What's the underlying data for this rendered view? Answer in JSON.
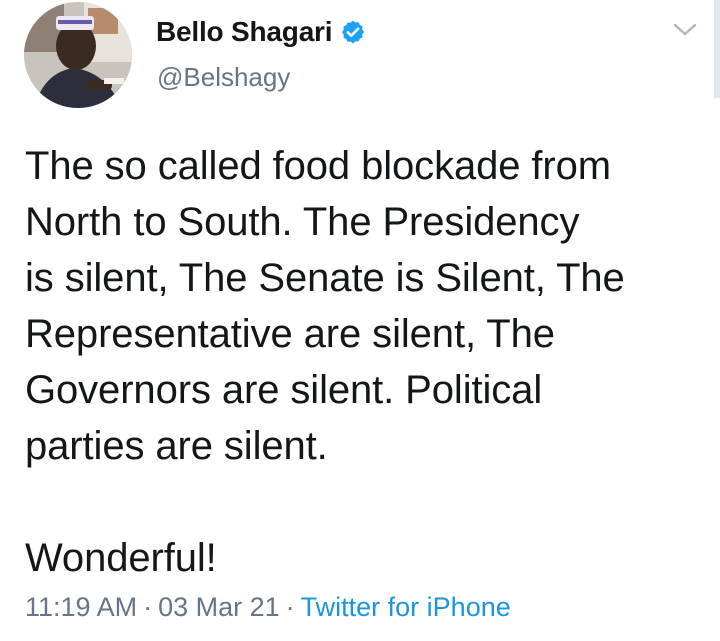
{
  "tweet": {
    "author": {
      "display_name": "Bello Shagari",
      "handle": "@Belshagy",
      "verified": true
    },
    "text": "The so called food blockade from\nNorth to South. The Presidency\nis silent, The Senate is Silent, The\nRepresentative are silent, The\nGovernors are silent. Political\nparties are silent.\n\nWonderful!",
    "time": "11:19 AM",
    "date": "03 Mar 21",
    "separator": "·",
    "source": "Twitter for iPhone"
  },
  "colors": {
    "text": "#14171a",
    "muted": "#657786",
    "accent": "#1b95e0",
    "verified": "#1da1f2"
  },
  "icons": {
    "verified": "verified-badge-icon",
    "menu": "chevron-down-icon"
  }
}
